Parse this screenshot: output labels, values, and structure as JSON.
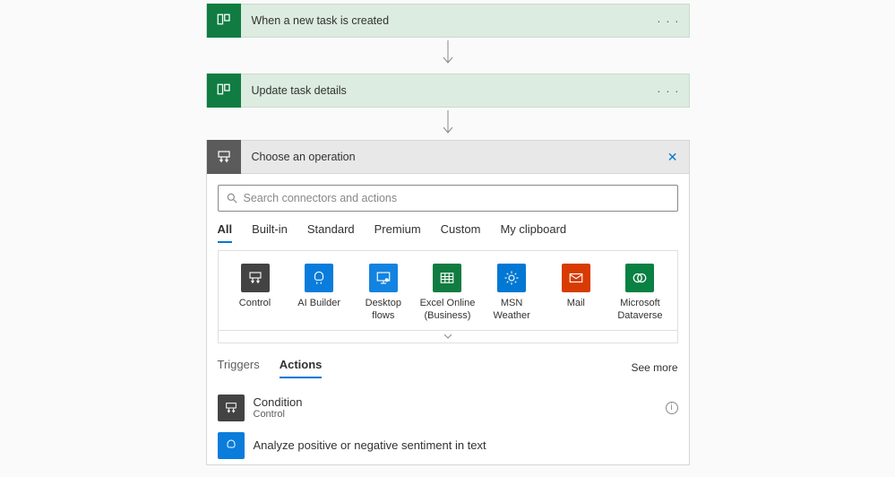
{
  "steps": [
    {
      "title": "When a new task is created",
      "icon": "planner-icon",
      "theme": "green"
    },
    {
      "title": "Update task details",
      "icon": "planner-icon",
      "theme": "green"
    }
  ],
  "choose_op": {
    "title": "Choose an operation",
    "search_placeholder": "Search connectors and actions"
  },
  "filter_tabs": [
    "All",
    "Built-in",
    "Standard",
    "Premium",
    "Custom",
    "My clipboard"
  ],
  "filter_active": 0,
  "connectors": [
    {
      "label": "Control",
      "icon": "control-icon",
      "bg": "#434343"
    },
    {
      "label": "AI Builder",
      "icon": "ai-icon",
      "bg": "#0a7cdb"
    },
    {
      "label": "Desktop flows",
      "icon": "desktop-icon",
      "bg": "#1283e0"
    },
    {
      "label": "Excel Online (Business)",
      "icon": "excel-icon",
      "bg": "#107c41"
    },
    {
      "label": "MSN Weather",
      "icon": "weather-icon",
      "bg": "#0078d4"
    },
    {
      "label": "Mail",
      "icon": "mail-icon",
      "bg": "#d83b01"
    },
    {
      "label": "Microsoft Dataverse",
      "icon": "dataverse-icon",
      "bg": "#088142"
    }
  ],
  "ta_tabs": [
    "Triggers",
    "Actions"
  ],
  "ta_active": 1,
  "see_more": "See more",
  "actions": [
    {
      "title": "Condition",
      "sub": "Control",
      "icon": "control-icon",
      "bg": "#434343"
    },
    {
      "title": "Analyze positive or negative sentiment in text",
      "sub": "",
      "icon": "ai-icon",
      "bg": "#0a7cdb"
    }
  ]
}
